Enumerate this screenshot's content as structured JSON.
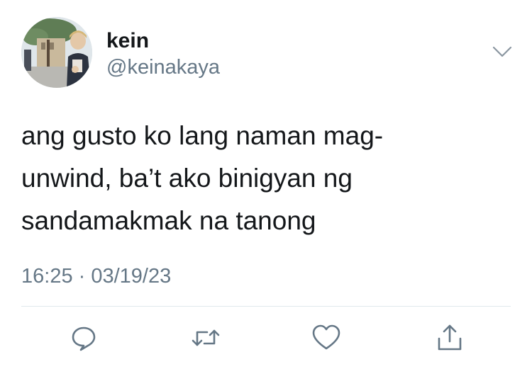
{
  "tweet": {
    "author_name": "kein",
    "author_handle": "@keinakaya",
    "text": "ang gusto ko lang naman mag-\nunwind, ba’t ako binigyan ng\nsandamakmak na tanong",
    "timestamp": "16:25 · 03/19/23"
  },
  "icons": {
    "more": "chevron-down-icon",
    "reply": "reply-icon",
    "retweet": "retweet-icon",
    "like": "heart-icon",
    "share": "share-icon"
  },
  "colors": {
    "text": "#14171a",
    "secondary": "#657786",
    "icon": "#657786",
    "divider": "#e1e8ed",
    "background": "#ffffff"
  }
}
